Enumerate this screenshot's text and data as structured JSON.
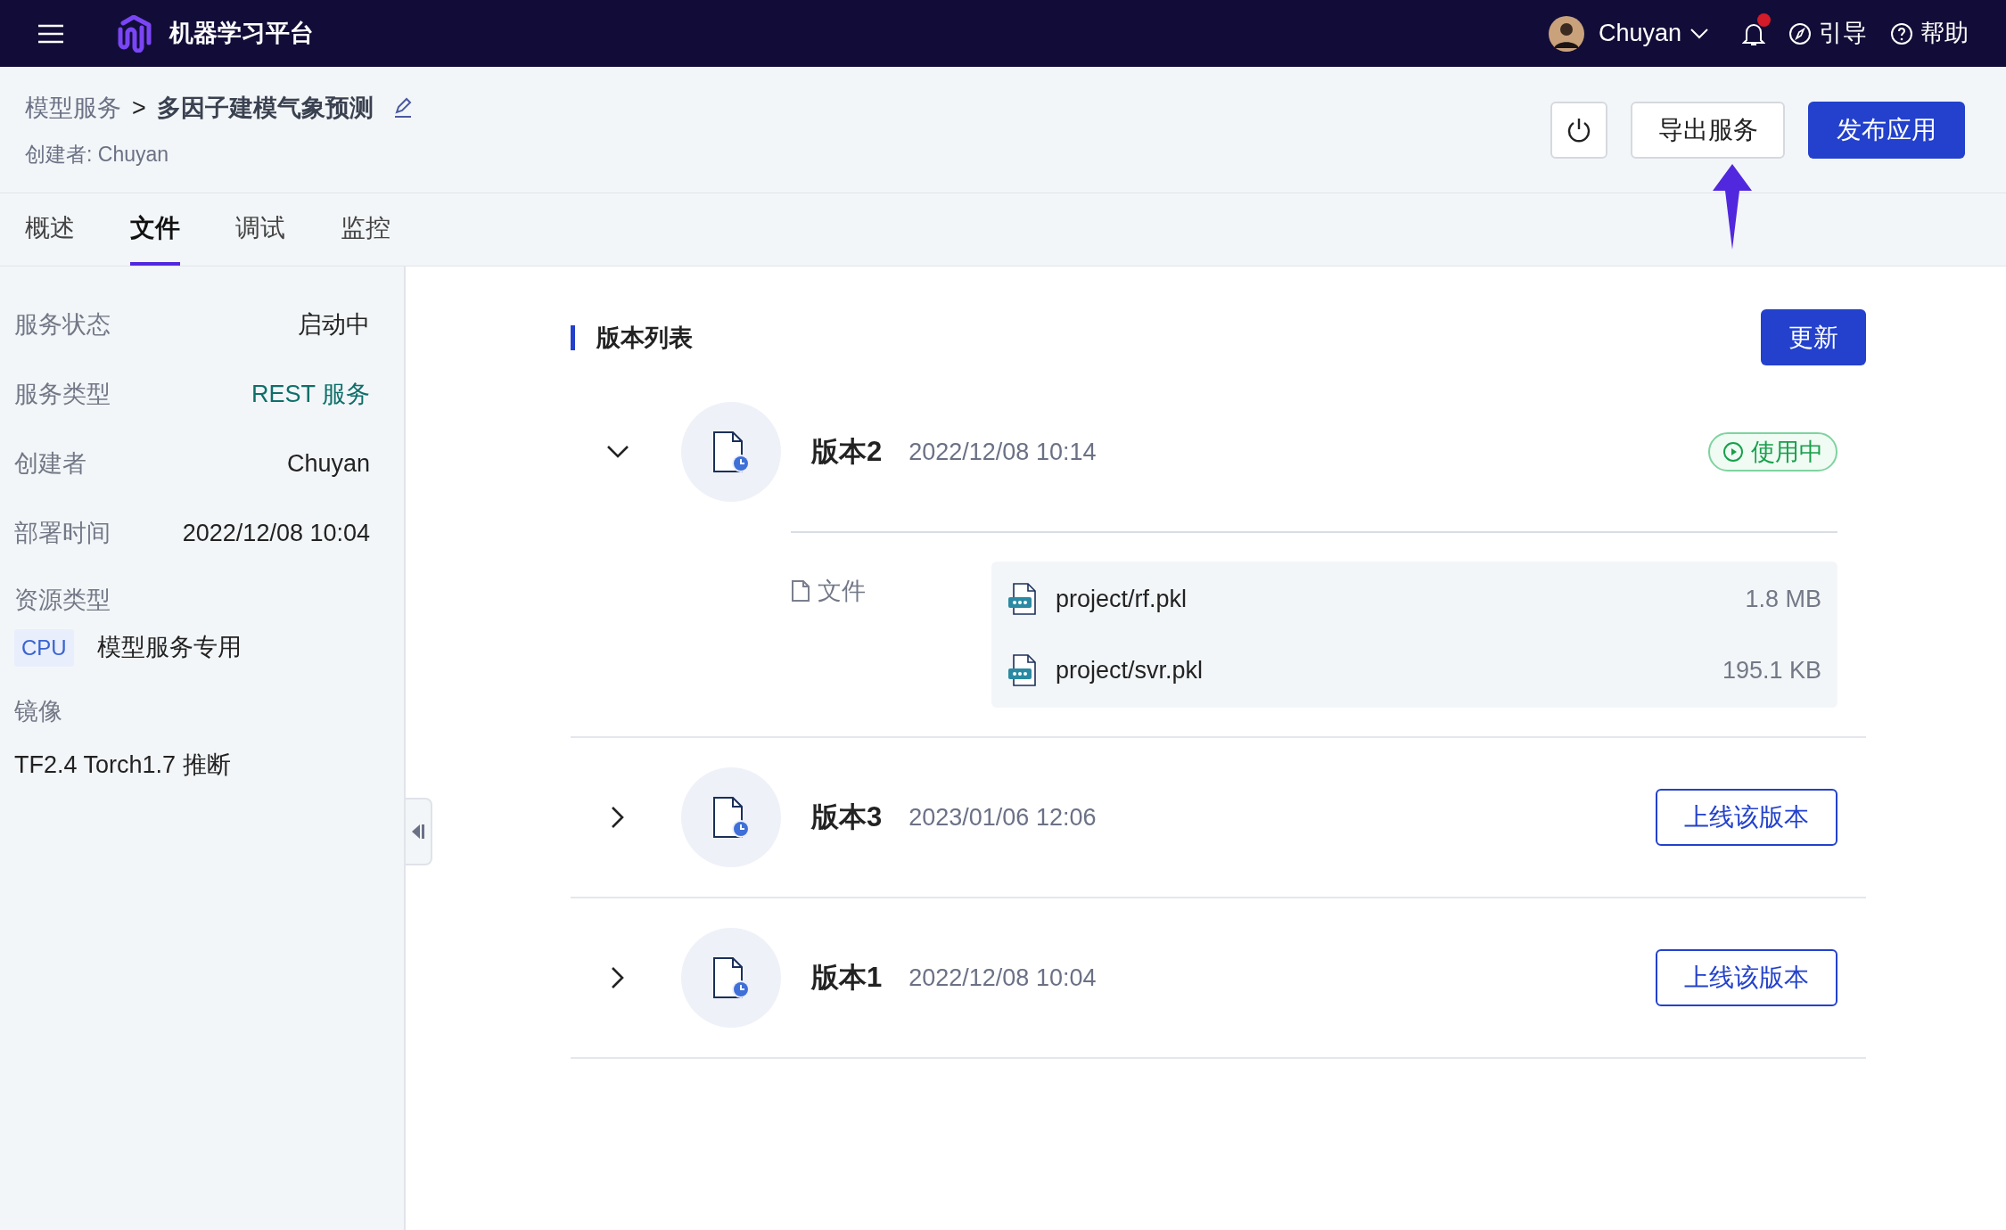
{
  "top_bar": {
    "title": "机器学习平台",
    "user": "Chuyan",
    "unread": true,
    "links": [
      {
        "kind": "guide",
        "label": "引导"
      },
      {
        "kind": "help",
        "label": "帮助"
      }
    ]
  },
  "header": {
    "breadcrumb": {
      "parent": "模型服务",
      "separator": ">",
      "current": "多因子建模气象预测"
    },
    "creator": "创建者: Chuyan",
    "actions": {
      "export": "导出服务",
      "publish": "发布应用"
    }
  },
  "tabs": [
    {
      "label": "概述",
      "selected": false
    },
    {
      "label": "文件",
      "selected": true
    },
    {
      "label": "调试",
      "selected": false
    },
    {
      "label": "监控",
      "selected": false
    }
  ],
  "sidebar": {
    "fields": [
      {
        "kind": "inline",
        "label": "服务状态",
        "value": "启动中",
        "highlight": false
      },
      {
        "kind": "inline",
        "label": "服务类型",
        "value": "REST 服务",
        "highlight": true
      },
      {
        "kind": "inline",
        "label": "创建者",
        "value": "Chuyan",
        "highlight": false
      },
      {
        "kind": "inline",
        "label": "部署时间",
        "value": "2022/12/08 10:04",
        "highlight": false
      },
      {
        "kind": "tagged",
        "label": "资源类型",
        "tag": "CPU",
        "value": "模型服务专用"
      },
      {
        "kind": "stacked",
        "label": "镜像",
        "value": "TF2.4 Torch1.7 推断"
      }
    ]
  },
  "versions": {
    "heading": "版本列表",
    "refresh": "更新",
    "items": [
      {
        "title": "版本2",
        "time": "2022/12/08 10:14",
        "expanded": true,
        "kind": "badge",
        "status": "使用中",
        "files_label": "文件",
        "files": [
          {
            "name": "project/rf.pkl",
            "size": "1.8 MB"
          },
          {
            "name": "project/svr.pkl",
            "size": "195.1 KB"
          }
        ]
      },
      {
        "title": "版本3",
        "time": "2023/01/06 12:06",
        "expanded": false,
        "kind": "button",
        "action": "上线该版本"
      },
      {
        "title": "版本1",
        "time": "2022/12/08 10:04",
        "expanded": false,
        "kind": "button",
        "action": "上线该版本"
      }
    ]
  }
}
